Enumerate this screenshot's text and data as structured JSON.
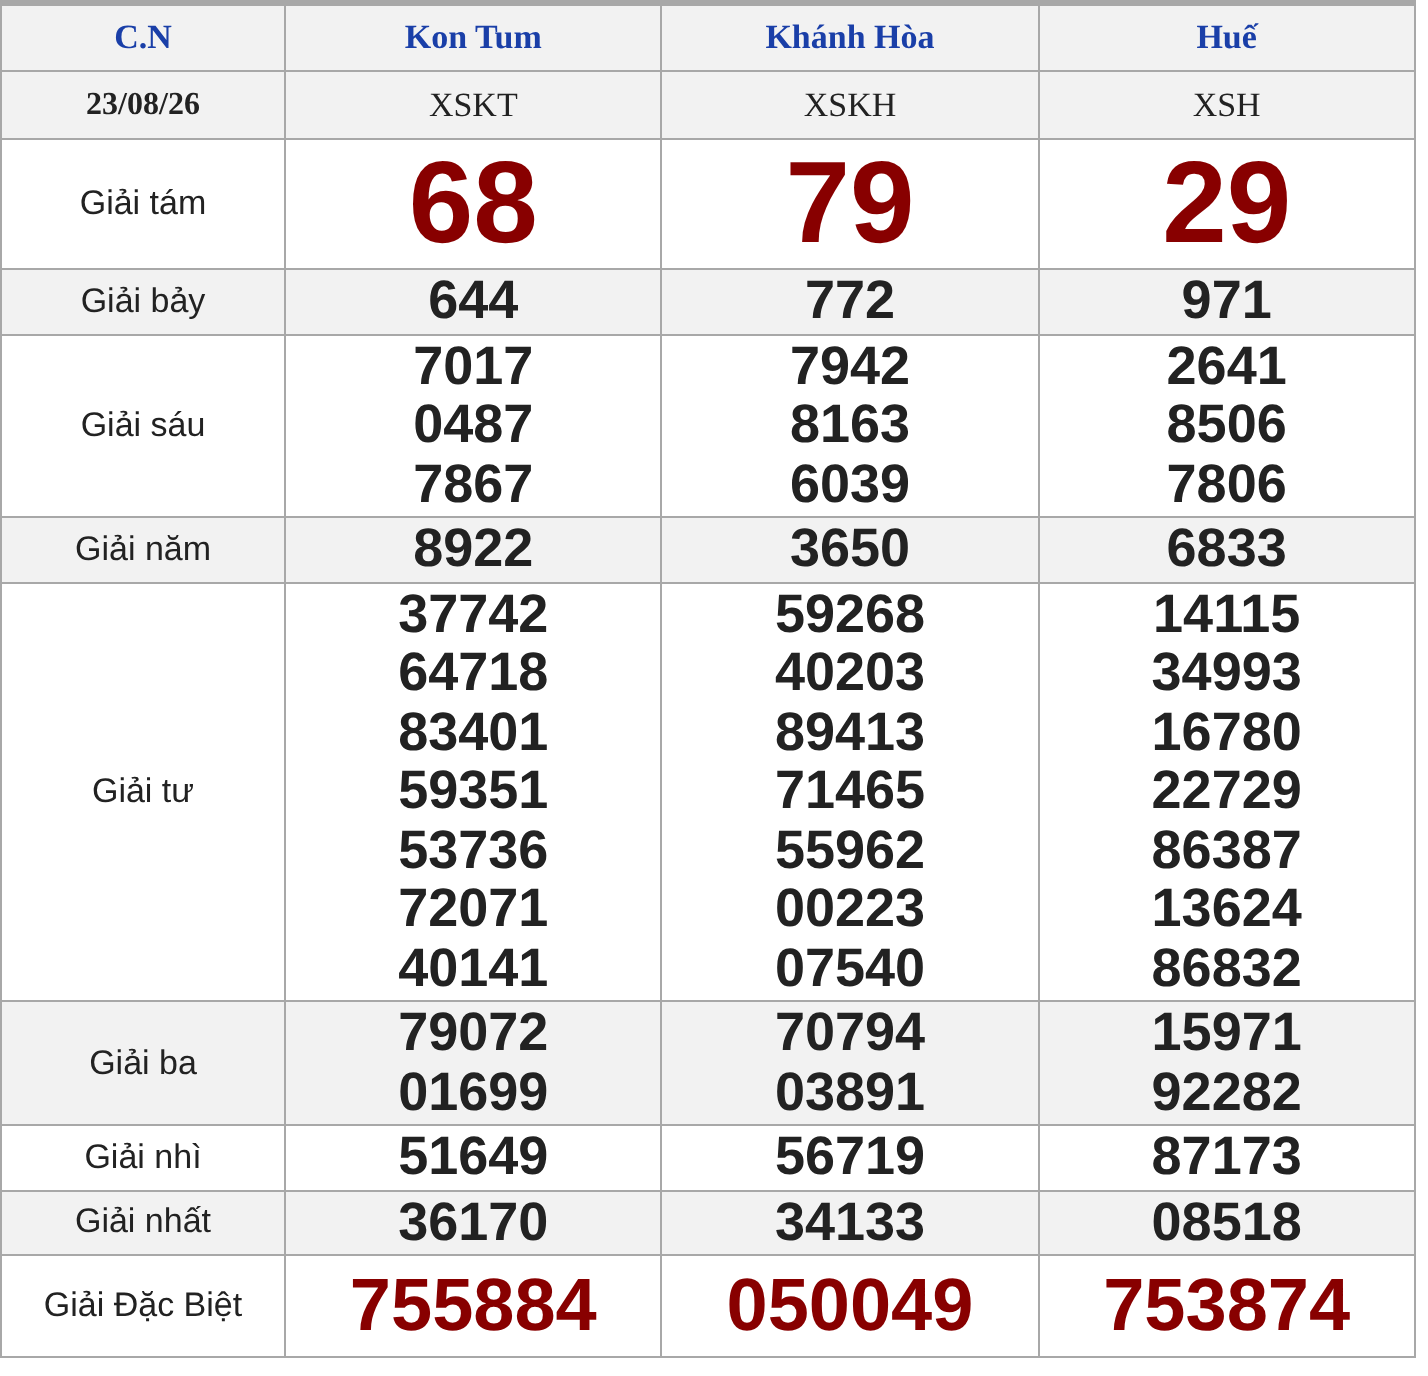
{
  "header": {
    "day": "C.N",
    "provinces": [
      "Kon Tum",
      "Khánh Hòa",
      "Huế"
    ]
  },
  "codes": {
    "date": "23/08/26",
    "values": [
      "XSKT",
      "XSKH",
      "XSH"
    ]
  },
  "prizes": [
    {
      "label": "Giải tám",
      "kind": "big",
      "cells": [
        [
          "68"
        ],
        [
          "79"
        ],
        [
          "29"
        ]
      ]
    },
    {
      "label": "Giải bảy",
      "kind": "normal",
      "cells": [
        [
          "644"
        ],
        [
          "772"
        ],
        [
          "971"
        ]
      ]
    },
    {
      "label": "Giải sáu",
      "kind": "normal",
      "cells": [
        [
          "7017",
          "0487",
          "7867"
        ],
        [
          "7942",
          "8163",
          "6039"
        ],
        [
          "2641",
          "8506",
          "7806"
        ]
      ]
    },
    {
      "label": "Giải năm",
      "kind": "normal",
      "cells": [
        [
          "8922"
        ],
        [
          "3650"
        ],
        [
          "6833"
        ]
      ]
    },
    {
      "label": "Giải tư",
      "kind": "normal",
      "cells": [
        [
          "37742",
          "64718",
          "83401",
          "59351",
          "53736",
          "72071",
          "40141"
        ],
        [
          "59268",
          "40203",
          "89413",
          "71465",
          "55962",
          "00223",
          "07540"
        ],
        [
          "14115",
          "34993",
          "16780",
          "22729",
          "86387",
          "13624",
          "86832"
        ]
      ]
    },
    {
      "label": "Giải ba",
      "kind": "normal",
      "cells": [
        [
          "79072",
          "01699"
        ],
        [
          "70794",
          "03891"
        ],
        [
          "15971",
          "92282"
        ]
      ]
    },
    {
      "label": "Giải nhì",
      "kind": "normal",
      "cells": [
        [
          "51649"
        ],
        [
          "56719"
        ],
        [
          "87173"
        ]
      ]
    },
    {
      "label": "Giải nhất",
      "kind": "normal",
      "cells": [
        [
          "36170"
        ],
        [
          "34133"
        ],
        [
          "08518"
        ]
      ]
    },
    {
      "label": "Giải Đặc Biệt",
      "kind": "special",
      "cells": [
        [
          "755884"
        ],
        [
          "050049"
        ],
        [
          "753874"
        ]
      ]
    }
  ]
}
